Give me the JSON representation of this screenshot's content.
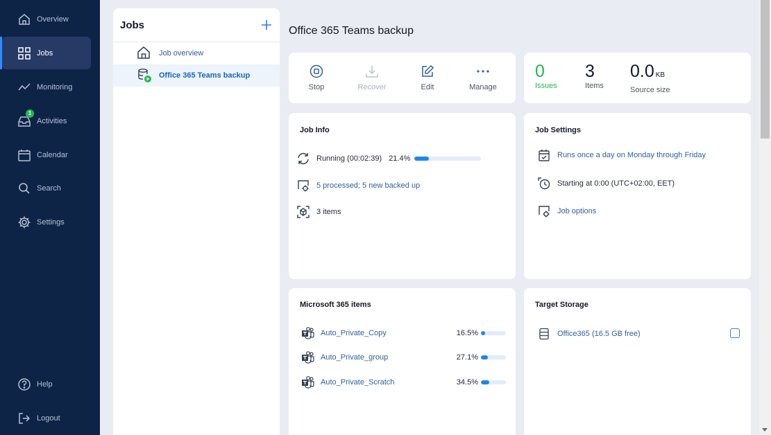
{
  "sidebar": {
    "items": [
      {
        "label": "Overview",
        "icon": "home-icon"
      },
      {
        "label": "Jobs",
        "icon": "grid-icon",
        "active": true
      },
      {
        "label": "Monitoring",
        "icon": "chart-line-icon"
      },
      {
        "label": "Activities",
        "icon": "inbox-icon",
        "badge": "1"
      },
      {
        "label": "Calendar",
        "icon": "calendar-icon"
      },
      {
        "label": "Search",
        "icon": "search-icon"
      },
      {
        "label": "Settings",
        "icon": "gear-icon"
      }
    ],
    "bottom": [
      {
        "label": "Help",
        "icon": "help-icon"
      },
      {
        "label": "Logout",
        "icon": "logout-icon"
      }
    ]
  },
  "jobs_panel": {
    "title": "Jobs",
    "items": [
      {
        "label": "Job overview"
      },
      {
        "label": "Office 365 Teams backup",
        "selected": true
      }
    ]
  },
  "page_title": "Office 365 Teams backup",
  "actions": [
    {
      "label": "Stop",
      "icon": "stop-icon",
      "enabled": true
    },
    {
      "label": "Recover",
      "icon": "download-icon",
      "enabled": false
    },
    {
      "label": "Edit",
      "icon": "edit-icon",
      "enabled": true
    },
    {
      "label": "Manage",
      "icon": "more-icon",
      "enabled": true
    }
  ],
  "stats": {
    "issues": {
      "value": "0",
      "label": "Issues"
    },
    "items": {
      "value": "3",
      "label": "Items"
    },
    "source_size": {
      "value": "0.0",
      "unit": "KB",
      "label": "Source size"
    }
  },
  "job_info": {
    "title": "Job Info",
    "status": "Running (00:02:39)",
    "progress_text": "21.4%",
    "progress": 0.214,
    "processed": "5 processed; 5 new backed up",
    "items": "3 items"
  },
  "job_settings": {
    "title": "Job Settings",
    "schedule": "Runs once a day on Monday through Friday",
    "start": "Starting at 0:00 (UTC+02:00, EET)",
    "options": "Job options"
  },
  "m365": {
    "title": "Microsoft 365 items",
    "items": [
      {
        "name": "Auto_Private_Copy",
        "percent": "16.5%",
        "progress": 0.165
      },
      {
        "name": "Auto_Private_group",
        "percent": "27.1%",
        "progress": 0.271
      },
      {
        "name": "Auto_Private_Scratch",
        "percent": "34.5%",
        "progress": 0.345
      }
    ]
  },
  "target_storage": {
    "title": "Target Storage",
    "name": "Office365 (16.5 GB free)"
  },
  "colors": {
    "sidebar_bg": "#0d2447",
    "accent": "#1f86e9",
    "success": "#1fba4f",
    "link": "#2f5f9d"
  }
}
